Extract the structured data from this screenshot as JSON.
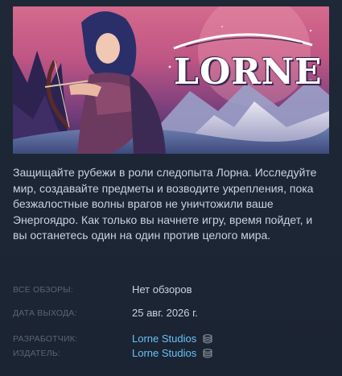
{
  "game": {
    "logo_text": "LORNE",
    "description": "Защищайте рубежи в роли следопыта Лорна. Исследуйте мир, создавайте предметы и возводите укрепления, пока безжалостные волны врагов не уничтожили ваше Энергоядро. Как только вы начнете игру, время пойдет, и вы останетесь один на один против целого мира."
  },
  "meta": {
    "reviews_label": "ВСЕ ОБЗОРЫ:",
    "reviews_value": "Нет обзоров",
    "release_label": "ДАТА ВЫХОДА:",
    "release_value": "25 авг. 2026 г.",
    "developer_label": "РАЗРАБОТЧИК:",
    "developer_value": "Lorne Studios",
    "publisher_label": "ИЗДАТЕЛЬ:",
    "publisher_value": "Lorne Studios"
  },
  "icons": {
    "developer_icon": "stack-icon",
    "publisher_icon": "stack-icon"
  },
  "colors": {
    "background": "#1b2838",
    "text": "#c6d4df",
    "label": "#556772",
    "link": "#67c1f5"
  }
}
